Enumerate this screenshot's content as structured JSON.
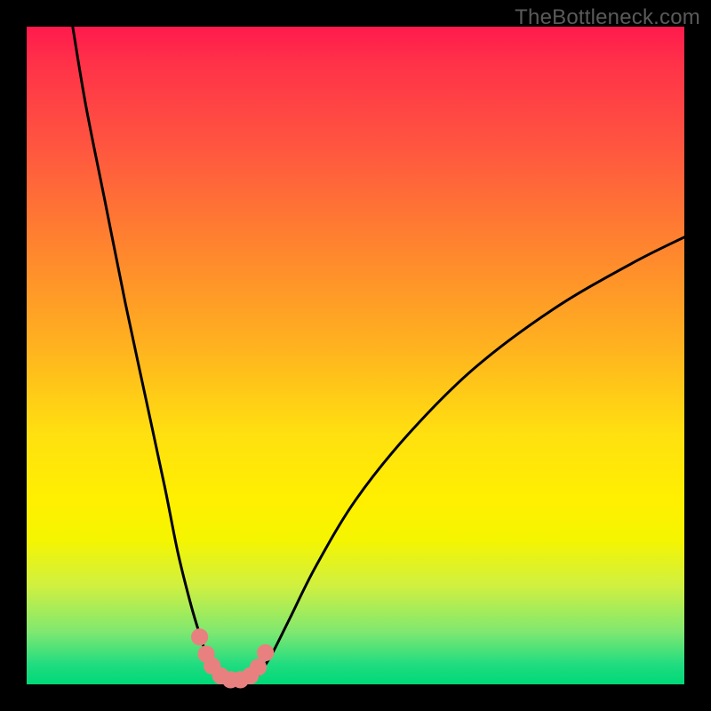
{
  "watermark": {
    "text": "TheBottleneck.com"
  },
  "colors": {
    "frame": "#000000",
    "curve_stroke": "#000000",
    "dots_fill": "#E98080",
    "gradient_top": "#ff1a4d",
    "gradient_mid": "#fff000",
    "gradient_bottom": "#00d878"
  },
  "chart_data": {
    "type": "line",
    "title": "",
    "xlabel": "",
    "ylabel": "",
    "xlim": [
      0,
      100
    ],
    "ylim": [
      0,
      100
    ],
    "legend": false,
    "grid": false,
    "annotations": [],
    "series": [
      {
        "name": "left-branch",
        "x": [
          7,
          9,
          12,
          15,
          18,
          21,
          23,
          25,
          26.5,
          27.5,
          28.3,
          29
        ],
        "y": [
          100,
          88,
          73,
          58,
          44,
          30,
          20,
          12,
          7,
          4,
          2.3,
          1.2
        ]
      },
      {
        "name": "right-branch",
        "x": [
          35,
          36,
          37.5,
          40,
          44,
          50,
          58,
          68,
          80,
          92,
          100
        ],
        "y": [
          1.2,
          2.5,
          5,
          10,
          18,
          28,
          38,
          48,
          57,
          64,
          68
        ]
      },
      {
        "name": "valley-floor",
        "x": [
          29,
          30.5,
          32,
          33.5,
          35
        ],
        "y": [
          1.2,
          0.6,
          0.5,
          0.6,
          1.2
        ]
      }
    ],
    "dots": {
      "name": "highlight-dots",
      "x": [
        26.3,
        27.3,
        28.2,
        29.5,
        31,
        32.5,
        34,
        35.2,
        36.3
      ],
      "y": [
        7.2,
        4.6,
        2.8,
        1.3,
        0.7,
        0.7,
        1.3,
        2.6,
        4.8
      ],
      "radius": 1.3
    }
  }
}
